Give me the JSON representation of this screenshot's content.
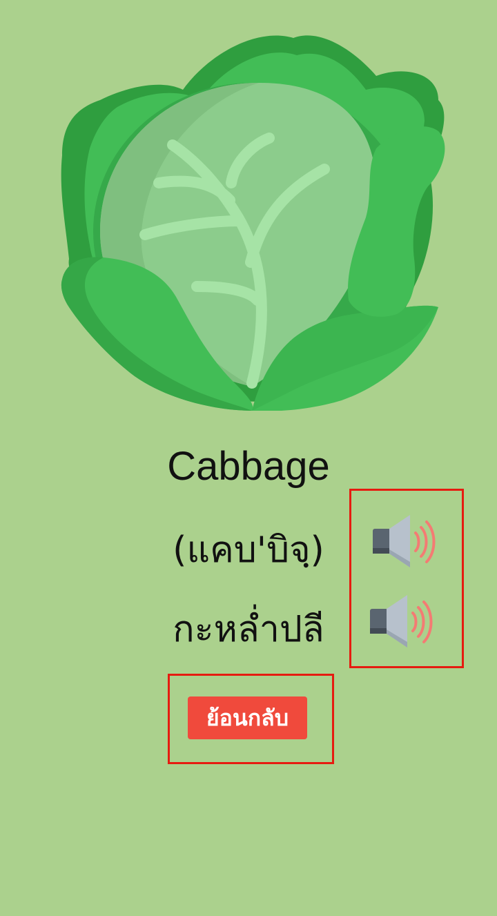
{
  "word": {
    "english": "Cabbage",
    "phonetic": "(แคบ'บิจฺ)",
    "thai": "กะหล่ำปลี"
  },
  "illustration": {
    "icon": "cabbage-icon"
  },
  "audio": {
    "english_icon": "speaker-icon",
    "thai_icon": "speaker-icon"
  },
  "back_button": {
    "label": "ย้อนกลับ"
  },
  "colors": {
    "background": "#abd18d",
    "button": "#f04a3c",
    "highlight_border": "#e61b10",
    "cabbage_dark": "#2f9e3f",
    "cabbage_mid": "#42bd56",
    "cabbage_core": "#8ccc8c",
    "cabbage_veins": "#a6e3a6"
  }
}
